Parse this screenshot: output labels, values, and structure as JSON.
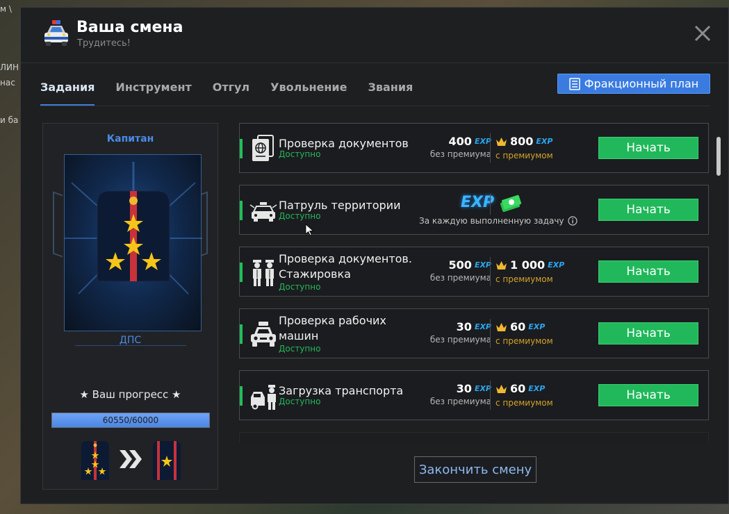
{
  "background": {
    "left_texts": [
      "м \\",
      "ЛИН",
      "нас",
      "и ба"
    ]
  },
  "header": {
    "title": "Ваша смена",
    "subtitle": "Трудитесь!",
    "icon": "police-car-icon"
  },
  "tabs": [
    {
      "label": "Задания",
      "active": true
    },
    {
      "label": "Инструмент",
      "active": false
    },
    {
      "label": "Отгул",
      "active": false
    },
    {
      "label": "Увольнение",
      "active": false
    },
    {
      "label": "Звания",
      "active": false
    }
  ],
  "plan_button": {
    "label": "Фракционный план",
    "icon": "checklist-icon"
  },
  "rank": {
    "name": "Капитан",
    "subdivision": "ДПС",
    "progress_title": "★ Ваш прогресс ★",
    "progress_text": "60550/60000",
    "progress_fraction": 1.0
  },
  "tasks": [
    {
      "title": "Проверка документов",
      "status": "Доступно",
      "icon": "passport-icon",
      "base_value": "400",
      "base_label": "без премиума",
      "premium_value": "800",
      "premium_label": "с премиумом",
      "exp_tag": "EXP",
      "button": "Начать"
    },
    {
      "title": "Патруль территории",
      "status": "Доступно",
      "icon": "patrol-car-icon",
      "reward_exp": "EXP",
      "reward_note": "За каждую выполненную задачу",
      "button": "Начать"
    },
    {
      "title": "Проверка документов. Стажировка",
      "status": "Доступно",
      "icon": "officers-icon",
      "base_value": "500",
      "base_label": "без премиума",
      "premium_value": "1 000",
      "premium_label": "с премиумом",
      "exp_tag": "EXP",
      "button": "Начать"
    },
    {
      "title": "Проверка рабочих машин",
      "status": "Доступно",
      "icon": "police-car-front-icon",
      "base_value": "30",
      "base_label": "без премиума",
      "premium_value": "60",
      "premium_label": "с премиумом",
      "exp_tag": "EXP",
      "button": "Начать"
    },
    {
      "title": "Загрузка транспорта",
      "status": "Доступно",
      "icon": "tow-truck-officer-icon",
      "base_value": "30",
      "base_label": "без премиума",
      "premium_value": "60",
      "premium_label": "с премиумом",
      "exp_tag": "EXP",
      "button": "Начать"
    }
  ],
  "end_button": "Закончить смену",
  "colors": {
    "accent_blue": "#3a7be0",
    "start_green": "#20b85a",
    "status_green": "#23b85a",
    "premium_gold": "#d4a22a",
    "exp_blue": "#2aa6f0"
  }
}
